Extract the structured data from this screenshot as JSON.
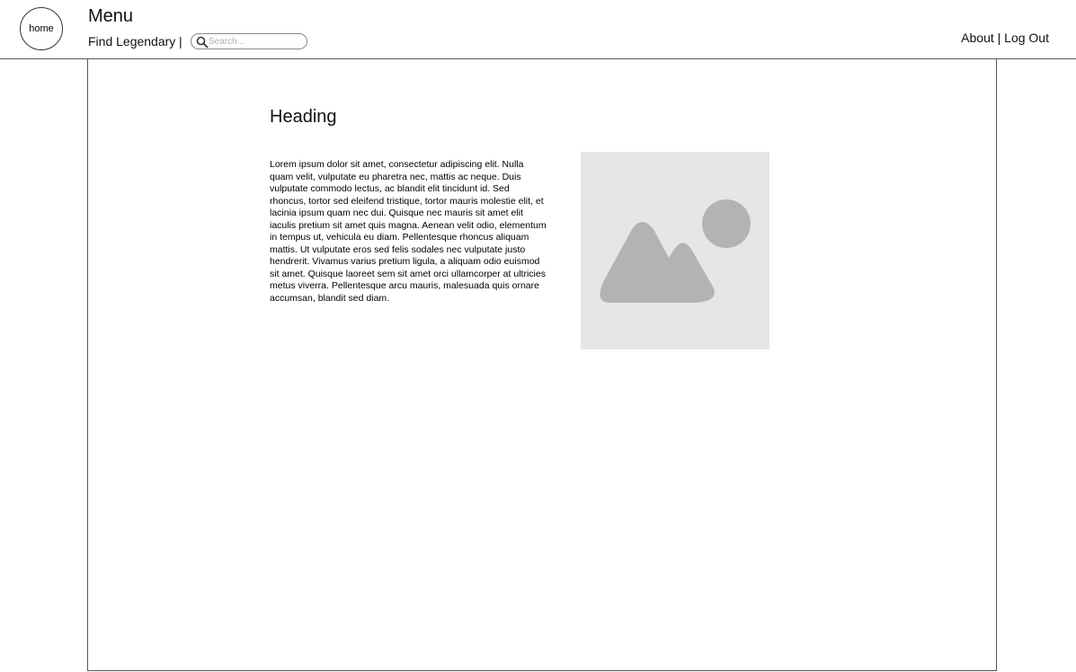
{
  "header": {
    "home_label": "home",
    "menu_title": "Menu",
    "find_link": "Find Legendary",
    "separator": "|",
    "search": {
      "placeholder": "Search...",
      "value": ""
    },
    "about_link": "About",
    "links_separator": "|",
    "logout_link": "Log Out"
  },
  "main": {
    "heading": "Heading",
    "body": "Lorem ipsum dolor sit amet, consectetur adipiscing elit. Nulla quam velit, vulputate eu pharetra nec, mattis ac neque. Duis vulputate commodo lectus, ac blandit elit tincidunt id. Sed rhoncus, tortor sed eleifend tristique, tortor mauris molestie elit, et lacinia ipsum quam nec dui. Quisque nec mauris sit amet elit iaculis pretium sit amet quis magna. Aenean velit odio, elementum in tempus ut, vehicula eu diam. Pellentesque rhoncus aliquam mattis. Ut vulputate eros sed felis sodales nec vulputate justo hendrerit. Vivamus varius pretium ligula, a aliquam odio euismod sit amet. Quisque laoreet sem sit amet orci ullamcorper at ultricies metus viverra. Pellentesque arcu mauris, malesuada quis ornare accumsan, blandit sed diam.",
    "image_icon": "image-placeholder-icon"
  },
  "colors": {
    "border": "#555555",
    "placeholder_bg": "#e6e6e6",
    "placeholder_shape": "#b3b3b3"
  }
}
